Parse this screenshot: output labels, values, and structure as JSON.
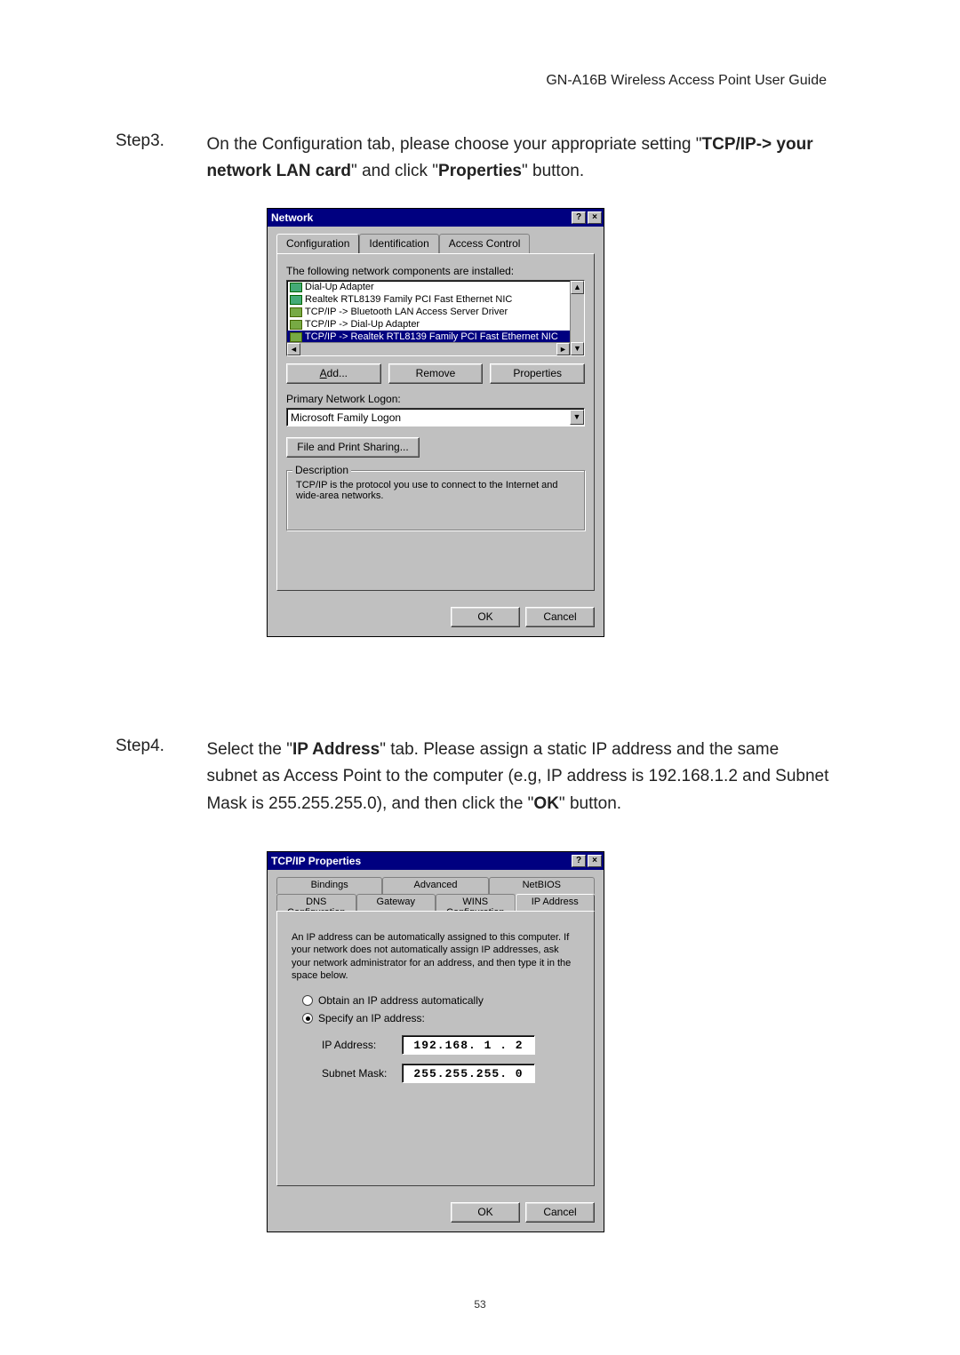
{
  "header": {
    "title": "GN-A16B Wireless Access Point User Guide"
  },
  "step3": {
    "label": "Step3.",
    "text_pre": "On the Configuration tab, please choose your appropriate setting \"",
    "bold1": "TCP/IP-> your network LAN card",
    "text_mid": "\" and click \"",
    "bold2": "Properties",
    "text_post": "\" button."
  },
  "dialog1": {
    "title": "Network",
    "help_btn": "?",
    "close_btn": "×",
    "tabs": {
      "configuration": "Configuration",
      "identification": "Identification",
      "access": "Access Control"
    },
    "installed_label": "The following network components are installed:",
    "list": {
      "item1": "Dial-Up Adapter",
      "item2": "Realtek RTL8139 Family PCI Fast Ethernet NIC",
      "item3": "TCP/IP -> Bluetooth LAN Access Server Driver",
      "item4": "TCP/IP -> Dial-Up Adapter",
      "item5": "TCP/IP -> Realtek RTL8139 Family PCI Fast Ethernet NIC"
    },
    "buttons": {
      "add": "Add...",
      "remove": "Remove",
      "properties": "Properties"
    },
    "primary_logon_label": "Primary Network Logon:",
    "primary_logon_value": "Microsoft Family Logon",
    "file_print_btn": "File and Print Sharing...",
    "desc_title": "Description",
    "desc_text": "TCP/IP is the protocol you use to connect to the Internet and wide-area networks.",
    "ok": "OK",
    "cancel": "Cancel"
  },
  "step4": {
    "label": "Step4.",
    "text_pre": "Select the \"",
    "bold1": "IP Address",
    "text_mid1": "\" tab. Please assign a static IP address and the same subnet as Access Point to the computer (e.g, IP address is 192.168.1.2 and Subnet Mask is 255.255.255.0), and then click the \"",
    "bold2": "OK",
    "text_post": "\" button."
  },
  "dialog2": {
    "title": "TCP/IP Properties",
    "help_btn": "?",
    "close_btn": "×",
    "tabs_back": {
      "bindings": "Bindings",
      "advanced": "Advanced",
      "netbios": "NetBIOS"
    },
    "tabs_front": {
      "dns": "DNS Configuration",
      "gateway": "Gateway",
      "wins": "WINS Configuration",
      "ip": "IP Address"
    },
    "info": "An IP address can be automatically assigned to this computer. If your network does not automatically assign IP addresses, ask your network administrator for an address, and then type it in the space below.",
    "radio_auto": "Obtain an IP address automatically",
    "radio_specify": "Specify an IP address:",
    "ip_label": "IP Address:",
    "ip_value": "192.168. 1 . 2",
    "mask_label": "Subnet Mask:",
    "mask_value": "255.255.255. 0",
    "ok": "OK",
    "cancel": "Cancel"
  },
  "page_number": "53"
}
